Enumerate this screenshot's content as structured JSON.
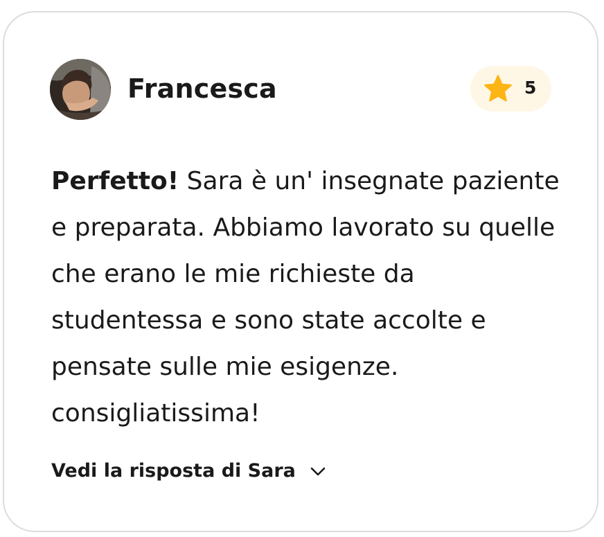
{
  "reviewer": {
    "name": "Francesca",
    "avatar_icon": "user-photo"
  },
  "rating": {
    "value": "5",
    "icon": "star-icon",
    "star_color": "#FDB515",
    "pill_color": "#FFF7E6"
  },
  "review": {
    "headline": "Perfetto!",
    "body": "Sara è un' insegnate paziente e preparata. Abbiamo lavorato su quelle che erano le mie richieste da studentessa e sono state accolte e pensate sulle mie esigenze. consigliatissima!"
  },
  "reply_toggle": {
    "label": "Vedi la risposta di Sara",
    "icon": "chevron-down-icon"
  }
}
